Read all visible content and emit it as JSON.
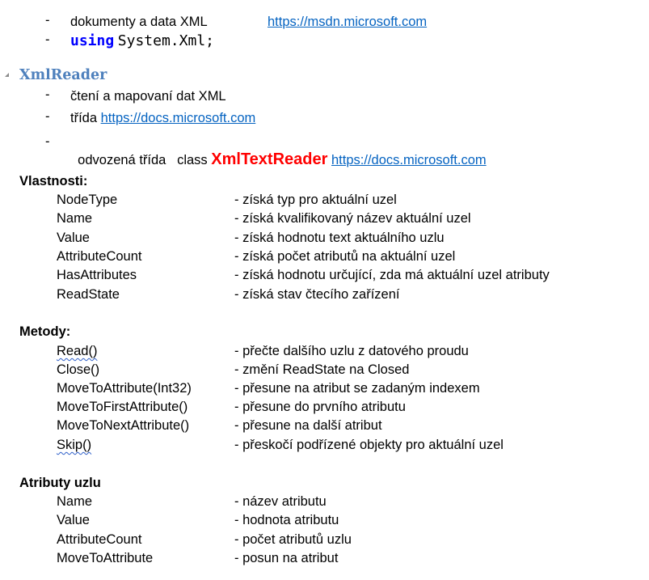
{
  "top": {
    "line1": {
      "dash": "-",
      "text": "dokumenty a data XML",
      "link": "https://msdn.microsoft.com"
    },
    "line2": {
      "dash": "-",
      "keyword": "using",
      "rest": "System.Xml;"
    }
  },
  "xmlreader": {
    "heading": "XmlReader",
    "items": [
      {
        "dash": "-",
        "text": "čtení a mapovaní dat XML"
      },
      {
        "dash": "-",
        "text": "třída ",
        "link": "https://docs.microsoft.com"
      },
      {
        "dash": "-",
        "text": "odvozená třída   class ",
        "highlight": "XmlTextReader",
        "link": "https://docs.microsoft.com"
      }
    ]
  },
  "vlastnosti": {
    "title": "Vlastnosti:",
    "rows": [
      {
        "name": "NodeType",
        "desc": "- získá typ pro aktuální uzel"
      },
      {
        "name": "Name",
        "desc": "- získá kvalifikovaný název aktuální uzel"
      },
      {
        "name": "Value",
        "desc": "- získá hodnotu text aktuálního uzlu"
      },
      {
        "name": "AttributeCount",
        "desc": "- získá počet atributů na aktuální uzel"
      },
      {
        "name": "HasAttributes",
        "desc": "- získá hodnotu určující, zda má aktuální uzel atributy"
      },
      {
        "name": "ReadState",
        "desc": "- získá stav čtecího zařízení"
      }
    ]
  },
  "metody": {
    "title": "Metody:",
    "rows": [
      {
        "name": "Read()",
        "desc": "- přečte dalšího uzlu z datového proudu"
      },
      {
        "name": "Close()",
        "desc": "- změní ReadState na Closed"
      },
      {
        "name": "MoveToAttribute(Int32)",
        "desc": "- přesune na atribut se zadaným indexem"
      },
      {
        "name": "MoveToFirstAttribute()",
        "desc": "- přesune do prvního atributu"
      },
      {
        "name": "MoveToNextAttribute()",
        "desc": "- přesune na další atribut"
      },
      {
        "name": "Skip()",
        "desc": "- přeskočí podřízené objekty pro aktuální uzel"
      }
    ]
  },
  "atributy": {
    "title": "Atributy uzlu",
    "rows": [
      {
        "name": "Name",
        "desc": "- název atributu"
      },
      {
        "name": "Value",
        "desc": "- hodnota atributu"
      },
      {
        "name": "AttributeCount",
        "desc": "- počet atributů uzlu"
      },
      {
        "name": "MoveToAttribute",
        "desc": "- posun na atribut"
      }
    ]
  }
}
